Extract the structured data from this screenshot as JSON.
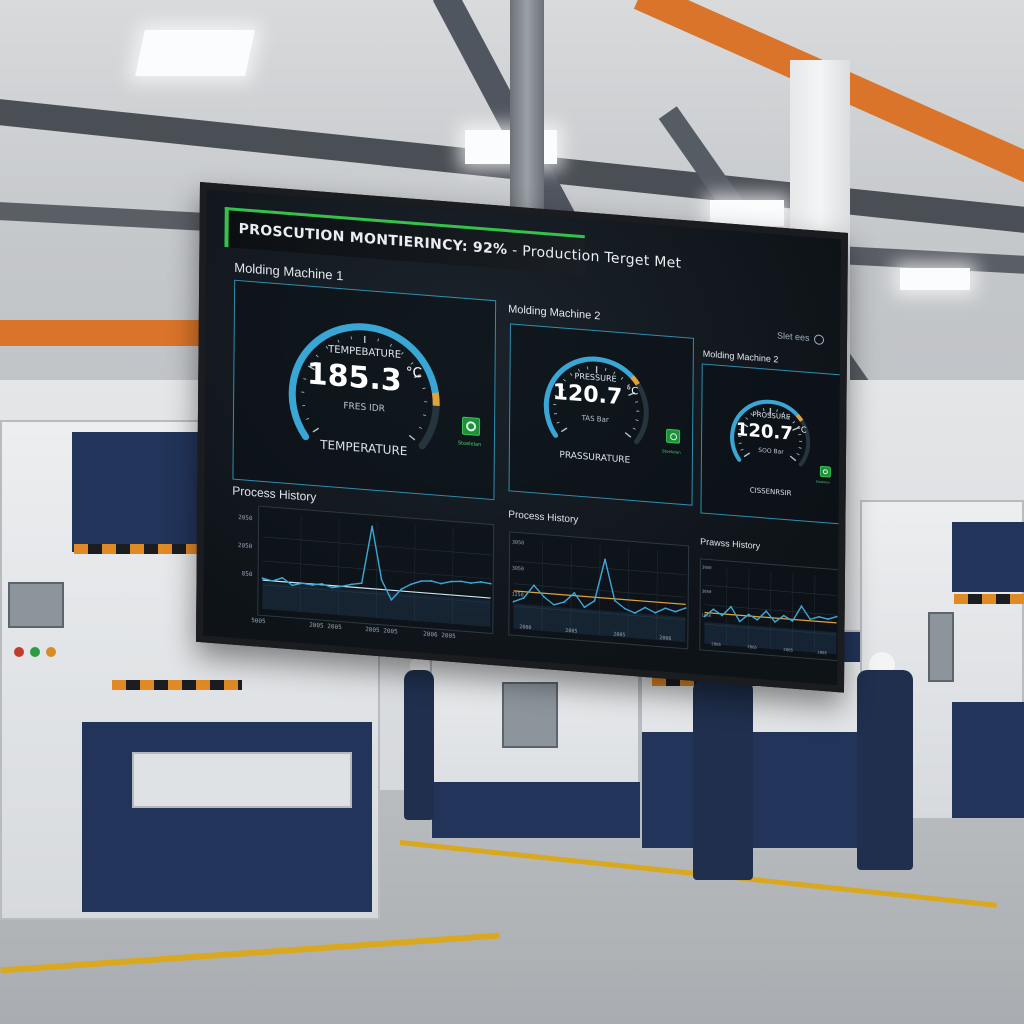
{
  "header": {
    "title": "PROSCUTION MONTIERINCY: 92%",
    "status": " - Production Terget Met"
  },
  "brand": "Slet ees",
  "machines": [
    {
      "name": "Molding Machine 1",
      "gauge_label": "TEMPEBATURE",
      "value": "185.3",
      "unit": "°C",
      "sub": "FRES IDR",
      "caption": "TEMPERATURE",
      "ok_text": "Stoelelan",
      "level": 0.82,
      "accent": "#3aa6d6"
    },
    {
      "name": "Molding Machine 2",
      "gauge_label": "PRESSURE",
      "value": "120.7",
      "unit": "°C",
      "sub": "TAS Bar",
      "caption": "PRASSURATURE",
      "ok_text": "Stoelelan",
      "level": 0.68,
      "accent": "#3aa6d6"
    },
    {
      "name": "Molding Machine 2",
      "gauge_label": "PROSSURE",
      "value": "120.7",
      "unit": "°C",
      "sub": "SOO Bar",
      "caption": "CISSENRSIR",
      "ok_text": "Stoelelan",
      "level": 0.68,
      "accent": "#3aa6d6"
    }
  ],
  "history": [
    {
      "title": "Process History",
      "y_ticks": [
        "2050",
        "2050",
        "850"
      ],
      "x_ticks": [
        "5005",
        "2005 2005",
        "2005 2005",
        "2006 2005"
      ],
      "values": [
        0.32,
        0.3,
        0.34,
        0.27,
        0.3,
        0.29,
        0.31,
        0.28,
        0.3,
        0.33,
        0.35,
        0.95,
        0.4,
        0.2,
        0.32,
        0.38,
        0.42,
        0.43,
        0.41,
        0.44,
        0.45,
        0.44,
        0.46,
        0.45
      ],
      "baseline": 0.3,
      "line_color": "#3ea7d8",
      "baseline_color": "#c8e8f4"
    },
    {
      "title": "Process History",
      "y_ticks": [
        "3050",
        "3050",
        "1250"
      ],
      "x_ticks": [
        "2000",
        "2005",
        "2005",
        "2006"
      ],
      "values": [
        0.3,
        0.35,
        0.5,
        0.38,
        0.3,
        0.34,
        0.45,
        0.3,
        0.38,
        0.85,
        0.4,
        0.32,
        0.28,
        0.35,
        0.3,
        0.36,
        0.33,
        0.38
      ],
      "baseline": 0.42,
      "line_color": "#3ea7d8",
      "baseline_color": "#e0a23a"
    },
    {
      "title": "Prawss History",
      "y_ticks": [
        "3050",
        "3050",
        "1050"
      ],
      "x_ticks": [
        "2005",
        "2005",
        "2005",
        "2005"
      ],
      "values": [
        0.35,
        0.45,
        0.38,
        0.5,
        0.32,
        0.42,
        0.36,
        0.48,
        0.35,
        0.44,
        0.38,
        0.58,
        0.42,
        0.46,
        0.44,
        0.48
      ],
      "baseline": 0.4,
      "line_color": "#3ea7d8",
      "baseline_color": "#e0a23a"
    }
  ]
}
